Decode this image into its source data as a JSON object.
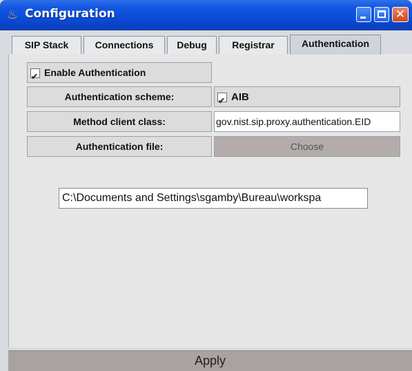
{
  "window": {
    "title": "Configuration",
    "icon": "java-cup-icon",
    "controls": [
      "minimize",
      "maximize",
      "close"
    ]
  },
  "tabs": [
    {
      "label": "SIP Stack",
      "active": false
    },
    {
      "label": "Connections",
      "active": false
    },
    {
      "label": "Debug",
      "active": false
    },
    {
      "label": "Registrar",
      "active": false
    },
    {
      "label": "Authentication",
      "active": true
    }
  ],
  "authentication": {
    "enable_label": "Enable Authentication",
    "enable_checked": true,
    "scheme_label": "Authentication scheme:",
    "scheme_value": "AIB",
    "scheme_checked": true,
    "method_label": "Method client class:",
    "method_value": "gov.nist.sip.proxy.authentication.EID",
    "file_label": "Authentication file:",
    "choose_label": "Choose",
    "path_value": "C:\\Documents and Settings\\sgamby\\Bureau\\workspa"
  },
  "footer": {
    "apply_label": "Apply"
  },
  "colors": {
    "titlebar": "#0a48d2",
    "panel_bg": "#e6e6e6",
    "choose_bg": "#b3acab",
    "apply_bg": "#aaa2a0"
  }
}
